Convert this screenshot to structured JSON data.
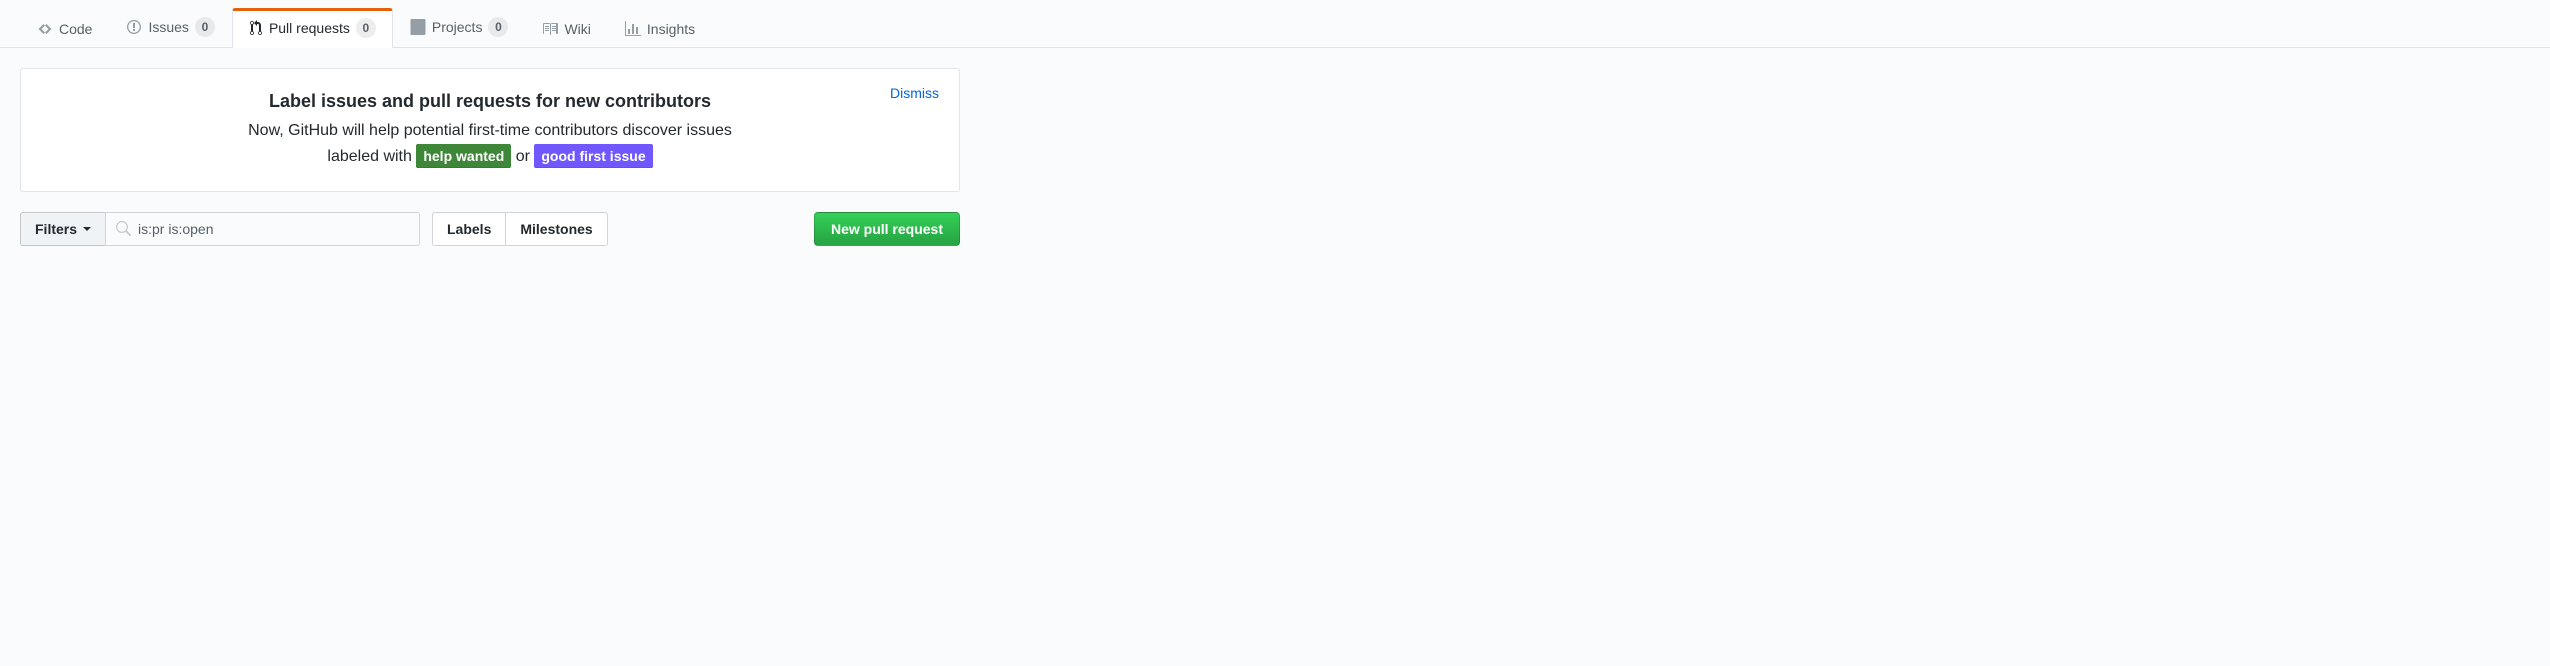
{
  "tabs": {
    "code": {
      "label": "Code"
    },
    "issues": {
      "label": "Issues",
      "count": "0"
    },
    "pulls": {
      "label": "Pull requests",
      "count": "0"
    },
    "projects": {
      "label": "Projects",
      "count": "0"
    },
    "wiki": {
      "label": "Wiki"
    },
    "insights": {
      "label": "Insights"
    }
  },
  "banner": {
    "title": "Label issues and pull requests for new contributors",
    "line1": "Now, GitHub will help potential first-time contributors discover issues",
    "line2_prefix": "labeled with ",
    "label_help": "help wanted",
    "label_help_color": "#3e8638",
    "line2_mid": " or ",
    "label_good": "good first issue",
    "label_good_color": "#7057ff",
    "dismiss": "Dismiss"
  },
  "subnav": {
    "filters_label": "Filters",
    "search_value": "is:pr is:open",
    "labels_btn": "Labels",
    "milestones_btn": "Milestones",
    "new_pr_btn": "New pull request"
  }
}
